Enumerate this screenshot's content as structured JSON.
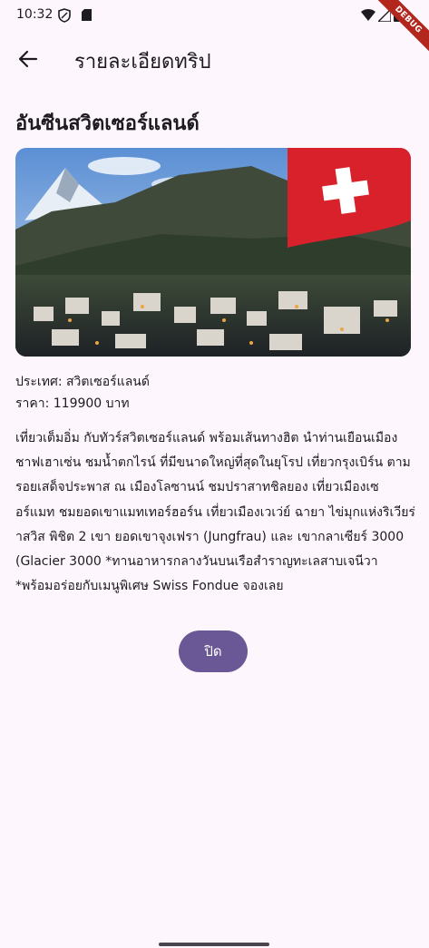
{
  "status_bar": {
    "time": "10:32",
    "debug_label": "DEBUG"
  },
  "app_bar": {
    "title": "รายละเอียดทริป",
    "back_icon": "arrow-left-icon"
  },
  "trip": {
    "title": "อันซีนสวิตเซอร์แลนด์",
    "country_line": "ประเทศ: สวิตเซอร์แลนด์",
    "price_line": "ราคา: 119900 บาท",
    "description": "เที่ยวเต็มอิ่ม กับทัวร์สวิตเซอร์แลนด์ พร้อมเส้นทางฮิต นำท่านเยือนเมืองชาฟเฮาเซ่น ชมน้ำตกไรน์ ที่มีขนาดใหญ่ที่สุดในยุโรป เที่ยวกรุงเบิร์น ตามรอยเสด็จประพาส ณ เมืองโลซานน์ ชมปราสาทชิลยอง เที่ยวเมืองเซอร์แมท ชมยอดเขาแมทเทอร์ฮอร์น เที่ยวเมืองเวเว่ย์ ฉายา ไข่มุกแห่งริเวียร่าสวิส พิชิต 2 เขา ยอดเขาจุงเฟรา (Jungfrau) และ เขากลาเซียร์ 3000 (Glacier 3000 *ทานอาหารกลางวันบนเรือสำราญทะเลสาบเจนีวา *พร้อมอร่อยกับเมนูพิเศษ Swiss Fondue จองเลย"
  },
  "actions": {
    "close_label": "ปิด"
  },
  "colors": {
    "background": "#fdf7fd",
    "accent": "#6a5795",
    "debug": "#b3261e"
  }
}
